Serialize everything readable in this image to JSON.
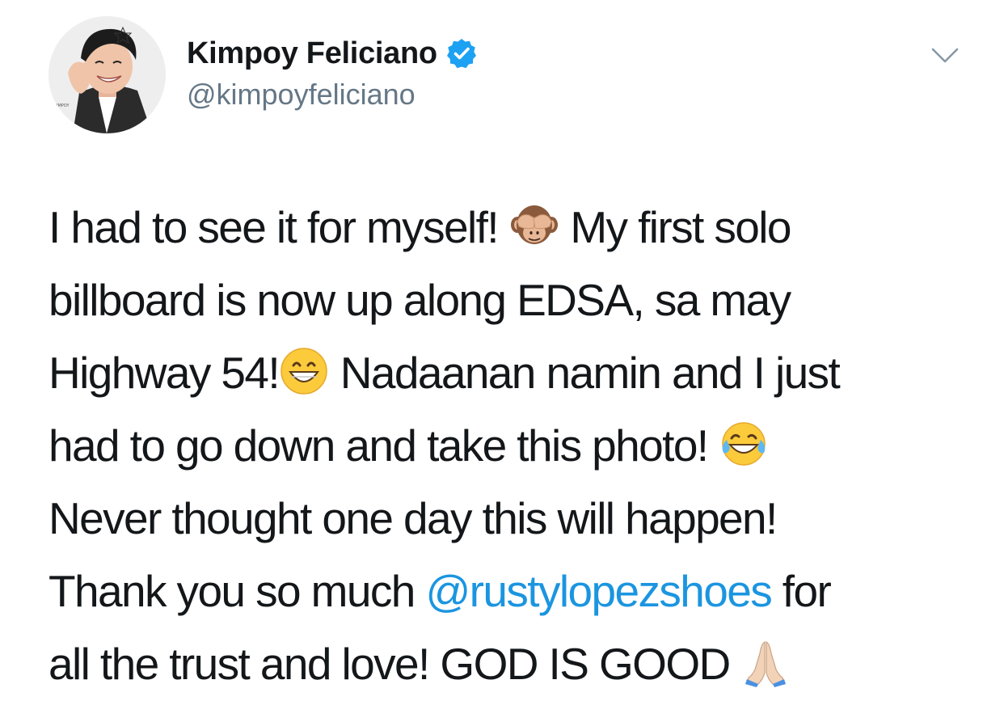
{
  "author": {
    "display_name": "Kimpoy Feliciano",
    "handle": "@kimpoyfeliciano",
    "verified": true
  },
  "menu": {
    "icon": "chevron-down-icon"
  },
  "tweet": {
    "segments": {
      "l1a": "I had to see it for myself! ",
      "l1b": " My first solo",
      "l2": "billboard is now up along EDSA, sa may",
      "l3a": "Highway 54!",
      "l3b": " Nadaanan namin and I just",
      "l4a": "had to go down and take this photo! ",
      "l5": "Never thought one day this will happen!",
      "l6a": "Thank you so much ",
      "l6mention": "@rustylopezshoes",
      "l6b": " for",
      "l7a": "all the trust and love! GOD IS GOOD "
    },
    "emojis": [
      "see-no-evil-monkey-emoji",
      "grinning-face-emoji",
      "tears-of-joy-emoji",
      "folded-hands-emoji"
    ]
  },
  "colors": {
    "text": "#14171a",
    "secondary": "#657786",
    "link": "#1b95e0",
    "verified": "#1da1f2"
  }
}
